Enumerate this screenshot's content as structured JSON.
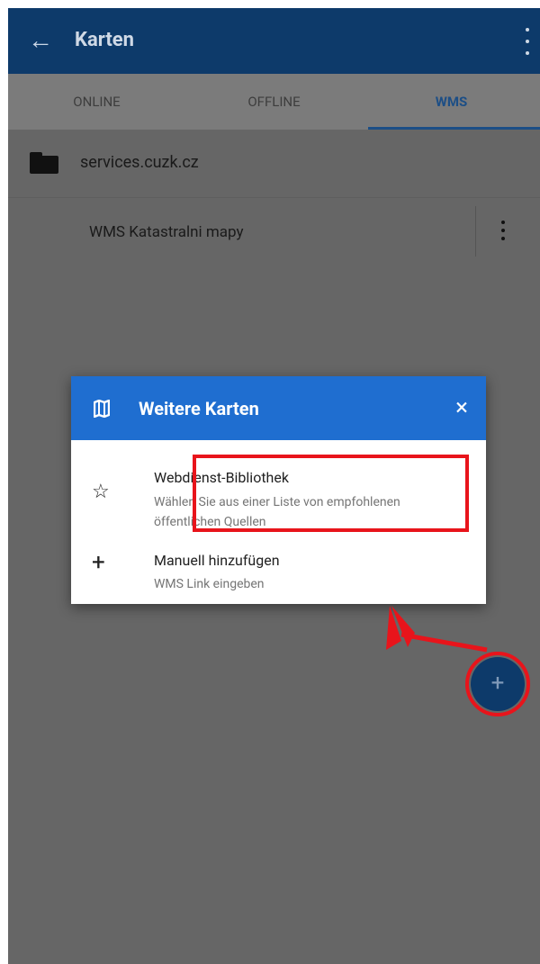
{
  "appbar": {
    "back_glyph": "←",
    "title": "Karten",
    "more_icon": "more-vert-icon"
  },
  "tabs": [
    {
      "label": "ONLINE",
      "active": false
    },
    {
      "label": "OFFLINE",
      "active": false
    },
    {
      "label": "WMS",
      "active": true
    }
  ],
  "list": {
    "folder": {
      "label": "services.cuzk.cz",
      "icon": "folder-icon"
    },
    "map": {
      "label": "WMS Katastralni mapy",
      "more_icon": "more-vert-icon"
    }
  },
  "dialog": {
    "title": "Weitere Karten",
    "close_glyph": "×",
    "options": [
      {
        "icon_glyph": "☆",
        "title": "Webdienst-Bibliothek",
        "subtitle": "Wählen Sie aus einer Liste von empfohlenen öffentlichen Quellen"
      },
      {
        "icon_glyph": "+",
        "title": "Manuell hinzufügen",
        "subtitle": "WMS Link eingeben"
      }
    ]
  },
  "fab": {
    "glyph": "+"
  },
  "colors": {
    "appbar": "#0d3a6a",
    "dialog_header": "#1f6ed0",
    "annotation_red": "#e8141b",
    "active_tab": "#1c4e86"
  }
}
